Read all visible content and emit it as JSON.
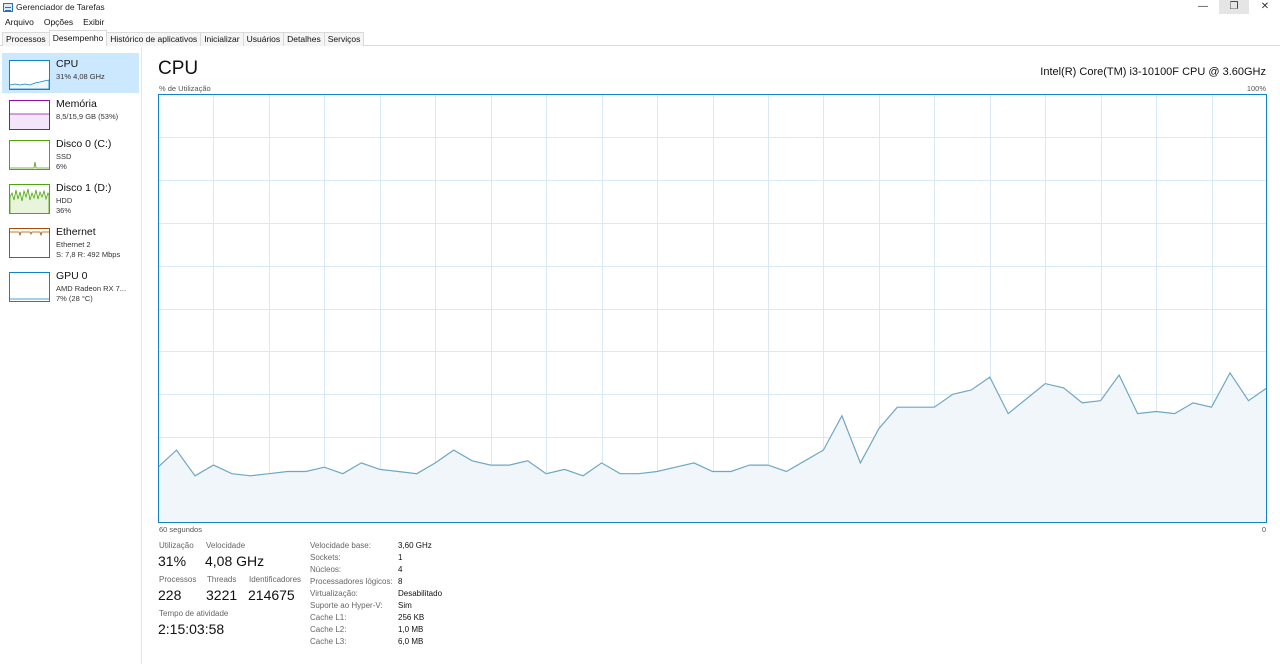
{
  "window": {
    "title": "Gerenciador de Tarefas",
    "minimize": "—",
    "restore": "❐",
    "close": "✕"
  },
  "menu": [
    "Arquivo",
    "Opções",
    "Exibir"
  ],
  "tabs": [
    "Processos",
    "Desempenho",
    "Histórico de aplicativos",
    "Inicializar",
    "Usuários",
    "Detalhes",
    "Serviços"
  ],
  "active_tab": "Desempenho",
  "sidebar": {
    "items": [
      {
        "title": "CPU",
        "lines": [
          "31% 4,08 GHz"
        ],
        "color": "#1183c6",
        "icon": "cpu-graph-icon"
      },
      {
        "title": "Memória",
        "lines": [
          "8,5/15,9 GB (53%)"
        ],
        "color": "#8b12ae",
        "icon": "memory-graph-icon"
      },
      {
        "title": "Disco 0 (C:)",
        "lines": [
          "SSD",
          "6%"
        ],
        "color": "#4da60c",
        "icon": "disk-graph-icon"
      },
      {
        "title": "Disco 1 (D:)",
        "lines": [
          "HDD",
          "36%"
        ],
        "color": "#4da60c",
        "icon": "disk-graph-icon"
      },
      {
        "title": "Ethernet",
        "lines": [
          "Ethernet 2",
          "S: 7,8 R: 492 Mbps"
        ],
        "color": "#a74f01",
        "icon": "network-graph-icon"
      },
      {
        "title": "GPU 0",
        "lines": [
          "AMD Radeon RX 7...",
          "7% (28 °C)"
        ],
        "color": "#1183c6",
        "icon": "gpu-graph-icon"
      }
    ]
  },
  "main": {
    "title": "CPU",
    "model": "Intel(R) Core(TM) i3-10100F CPU @ 3.60GHz",
    "axis_top_left": "% de Utilização",
    "axis_top_right": "100%",
    "axis_bottom_left": "60 segundos",
    "axis_bottom_right": "0"
  },
  "stats": {
    "utilization_label": "Utilização",
    "utilization": "31%",
    "speed_label": "Velocidade",
    "speed": "4,08 GHz",
    "processes_label": "Processos",
    "processes": "228",
    "threads_label": "Threads",
    "threads": "3221",
    "handles_label": "Identificadores",
    "handles": "214675",
    "uptime_label": "Tempo de atividade",
    "uptime": "2:15:03:58"
  },
  "details": [
    {
      "label": "Velocidade base:",
      "value": "3,60 GHz"
    },
    {
      "label": "Sockets:",
      "value": "1"
    },
    {
      "label": "Núcleos:",
      "value": "4"
    },
    {
      "label": "Processadores lógicos:",
      "value": "8"
    },
    {
      "label": "Virtualização:",
      "value": "Desabilitado"
    },
    {
      "label": "Suporte ao Hyper-V:",
      "value": "Sim"
    },
    {
      "label": "Cache L1:",
      "value": "256 KB"
    },
    {
      "label": "Cache L2:",
      "value": "1,0 MB"
    },
    {
      "label": "Cache L3:",
      "value": "6,0 MB"
    }
  ],
  "chart_data": {
    "type": "area",
    "x_range_seconds": [
      60,
      0
    ],
    "ylim": [
      0,
      100
    ],
    "grid": true,
    "colors": {
      "line": "#6fa7c3",
      "fill": "#f1f6fb",
      "grid": "#d9eaf4",
      "border": "#1183c6"
    },
    "values": [
      13,
      17,
      11,
      13.5,
      11.5,
      11,
      11.5,
      12,
      12,
      13,
      11.5,
      14,
      12.5,
      12,
      11.5,
      14,
      17,
      14.5,
      13.5,
      13.5,
      14.5,
      11.5,
      12.5,
      11,
      14,
      11.5,
      11.5,
      12,
      13,
      14,
      12,
      12,
      13.5,
      13.5,
      12,
      14.5,
      17,
      25,
      14,
      22,
      27,
      27,
      27,
      30,
      31,
      34,
      25.5,
      29,
      32.5,
      31.5,
      28,
      28.5,
      34.5,
      25.5,
      26,
      25.5,
      28,
      27,
      35,
      28.5,
      31.5
    ]
  }
}
